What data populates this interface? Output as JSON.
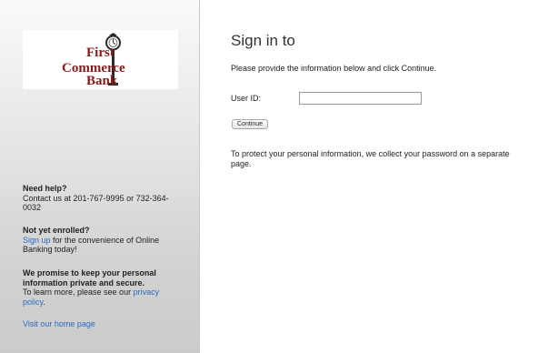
{
  "logo": {
    "line1": "First",
    "line2": "Commerce",
    "line3": "Bank",
    "brand_color": "#8b1a1a"
  },
  "sidebar": {
    "need_help_title": "Need help?",
    "need_help_text": "Contact us at 201-767-9995 or 732-364-0032",
    "not_enrolled_title": "Not yet enrolled?",
    "sign_up_link": "Sign up",
    "not_enrolled_text": " for the convenience of Online Banking today!",
    "promise_title": "We promise to keep your personal information private and secure.",
    "promise_text": "To learn more, please see our ",
    "privacy_link": "privacy policy",
    "privacy_suffix": ".",
    "home_link": "Visit our home page",
    "link_color": "#2a6bc2"
  },
  "main": {
    "title": "Sign in to",
    "instructions": "Please provide the information below and click Continue.",
    "user_id_label": "User ID:",
    "user_id_value": "",
    "continue_label": "Continue",
    "protect_text": "To protect your personal information, we collect your password on a separate page."
  }
}
